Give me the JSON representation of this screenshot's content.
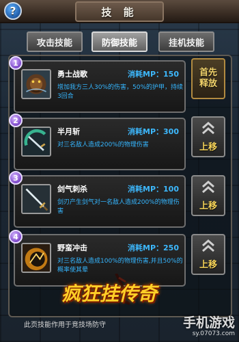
{
  "window": {
    "title": "技 能",
    "help_glyph": "?"
  },
  "tabs": [
    {
      "label": "攻击技能",
      "active": false
    },
    {
      "label": "防御技能",
      "active": true
    },
    {
      "label": "挂机技能",
      "active": false
    }
  ],
  "skills": [
    {
      "index": "1",
      "name": "勇士战歌",
      "cost": "消耗MP：150",
      "desc": "增加我方三人30%的伤害，50%的护甲，持续3回合",
      "icon": "beast-howl-icon",
      "action_line1": "首先",
      "action_line2": "释放"
    },
    {
      "index": "2",
      "name": "半月斩",
      "cost": "消耗MP：300",
      "desc": "对三名敌人造成200%的物理伤害",
      "icon": "sword-arc-icon",
      "action_label": "上移"
    },
    {
      "index": "3",
      "name": "剑气刺杀",
      "cost": "消耗MP：100",
      "desc": "剑刃产生剑气对一名敌人造成200%的物理伤害",
      "icon": "sword-thrust-icon",
      "action_label": "上移"
    },
    {
      "index": "4",
      "name": "野蛮冲击",
      "cost": "消耗MP：250",
      "desc": "对三名敌人造成100%的物理伤害,并且50%的概率使其晕",
      "icon": "charge-icon",
      "action_label": "上移"
    }
  ],
  "footer": {
    "note": "此页技能作用于竞技场防守"
  },
  "overlay": {
    "logo_text": "疯狂挂传奇",
    "watermark_text": "手机游戏",
    "watermark_url": "sy.07073.com"
  },
  "colors": {
    "desc_blue": "#35b6ff",
    "accent_gold": "#f6d45a"
  }
}
